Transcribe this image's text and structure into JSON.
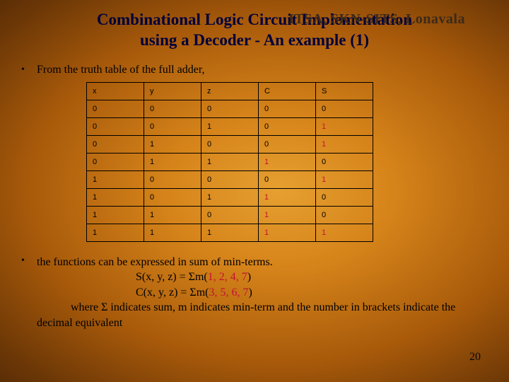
{
  "watermark": "ITSA, SKN-SITS, Lonavala",
  "title_line1": "Combinational Logic Circuit Implementation",
  "title_line2": "using a Decoder -  An example (1)",
  "bullets": {
    "b1": "From the truth table of the full adder,",
    "b2_intro": "the functions can be expressed in sum of min-terms.",
    "s_prefix": "S(x, y, z) = Σm(",
    "s_terms": "1, 2, 4, 7",
    "s_suffix": ")",
    "c_prefix": "C(x, y, z) = Σm(",
    "c_terms": "3, 5, 6, 7",
    "c_suffix": ")",
    "where": "where Σ indicates sum, m indicates min-term and the number in brackets indicate the decimal equivalent"
  },
  "table": {
    "headers": [
      "x",
      "y",
      "z",
      "C",
      "S"
    ],
    "rows": [
      {
        "x": "0",
        "y": "0",
        "z": "0",
        "C": "0",
        "S": "0",
        "hl": {
          "S": false,
          "C": false
        }
      },
      {
        "x": "0",
        "y": "0",
        "z": "1",
        "C": "0",
        "S": "1",
        "hl": {
          "S": true,
          "C": false
        }
      },
      {
        "x": "0",
        "y": "1",
        "z": "0",
        "C": "0",
        "S": "1",
        "hl": {
          "S": true,
          "C": false
        }
      },
      {
        "x": "0",
        "y": "1",
        "z": "1",
        "C": "1",
        "S": "0",
        "hl": {
          "S": false,
          "C": true
        }
      },
      {
        "x": "1",
        "y": "0",
        "z": "0",
        "C": "0",
        "S": "1",
        "hl": {
          "S": true,
          "C": false
        }
      },
      {
        "x": "1",
        "y": "0",
        "z": "1",
        "C": "1",
        "S": "0",
        "hl": {
          "S": false,
          "C": true
        }
      },
      {
        "x": "1",
        "y": "1",
        "z": "0",
        "C": "1",
        "S": "0",
        "hl": {
          "S": false,
          "C": true
        }
      },
      {
        "x": "1",
        "y": "1",
        "z": "1",
        "C": "1",
        "S": "1",
        "hl": {
          "S": true,
          "C": true
        }
      }
    ]
  },
  "page_number": "20"
}
